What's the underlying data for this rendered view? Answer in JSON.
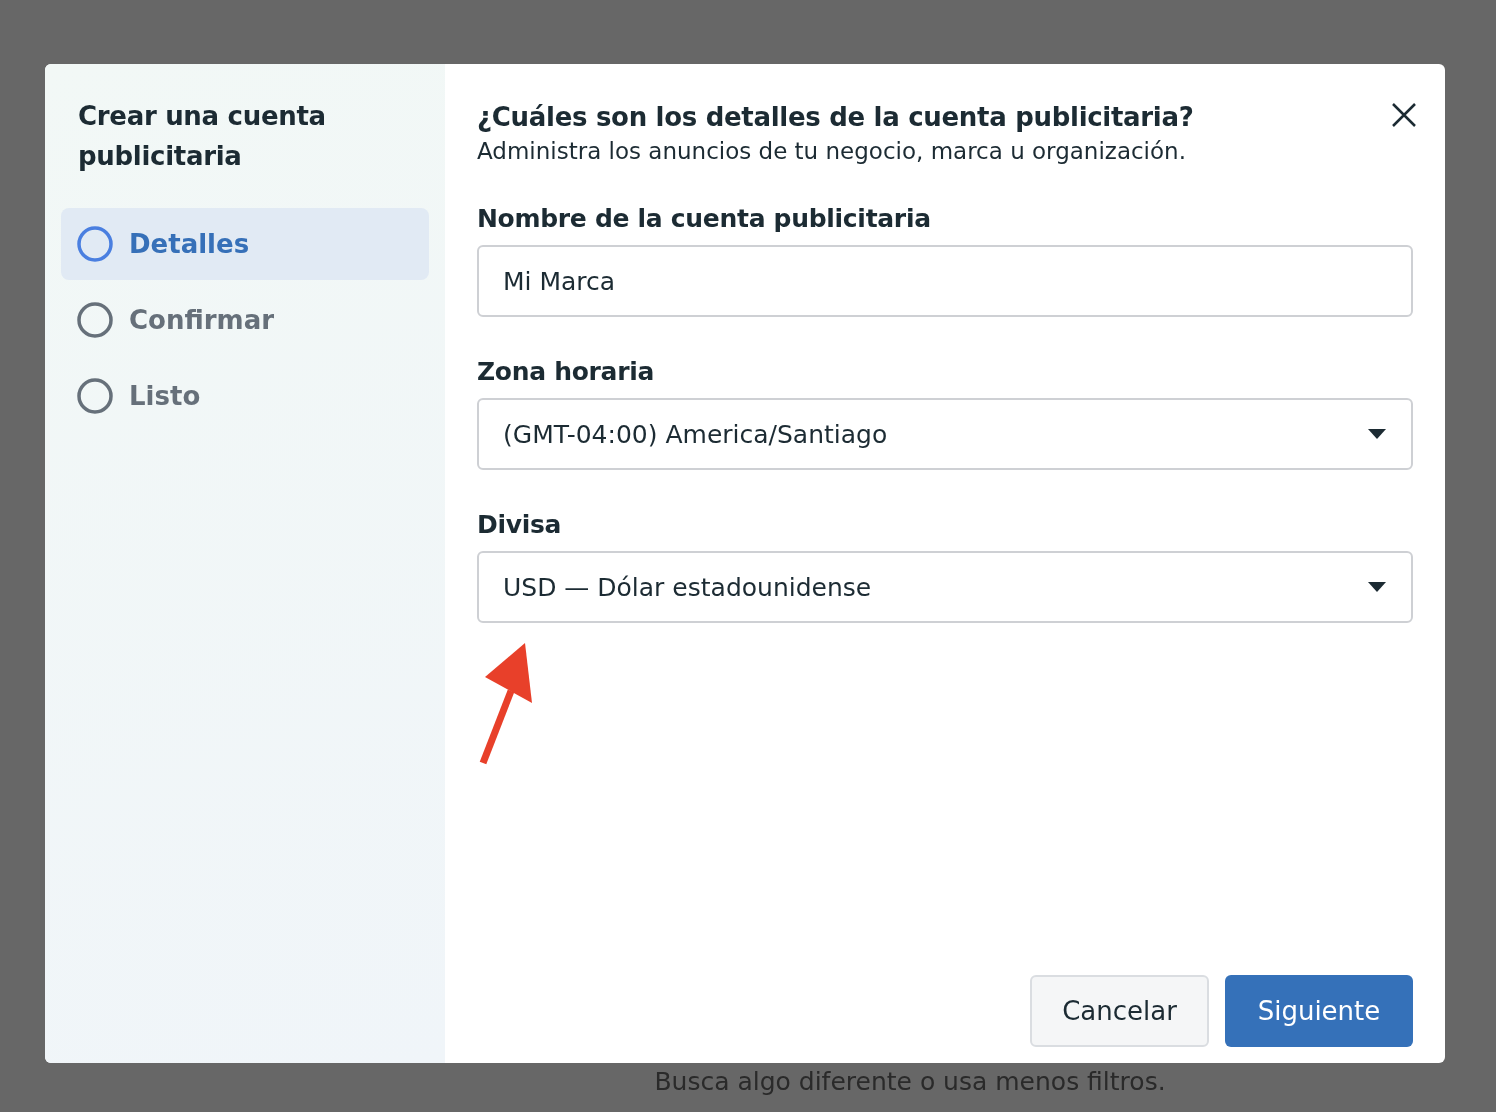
{
  "sidebar": {
    "title": "Crear una cuenta publicitaria",
    "steps": [
      {
        "label": "Detalles",
        "selected": true
      },
      {
        "label": "Confirmar",
        "selected": false
      },
      {
        "label": "Listo",
        "selected": false
      }
    ]
  },
  "dialog": {
    "title": "¿Cuáles son los detalles de la cuenta publicitaria?",
    "subtitle": "Administra los anuncios de tu negocio, marca u organización.",
    "fields": [
      {
        "kind": "text",
        "label": "Nombre de la cuenta publicitaria",
        "value": "Mi Marca"
      },
      {
        "kind": "select",
        "label": "Zona horaria",
        "value": "(GMT-04:00) America/Santiago"
      },
      {
        "kind": "select",
        "label": "Divisa",
        "value": "USD — Dólar estadounidense"
      }
    ],
    "buttons": [
      {
        "kind": "secondary",
        "label": "Cancelar"
      },
      {
        "kind": "primary",
        "label": "Siguiente"
      }
    ]
  },
  "background_text": "Busca algo diferente o usa menos filtros."
}
